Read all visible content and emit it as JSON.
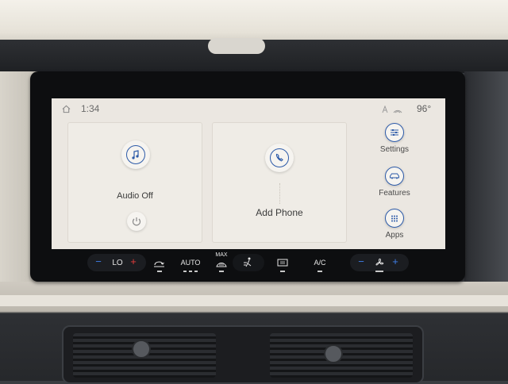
{
  "status": {
    "time": "1:34",
    "outside_temp": "96°"
  },
  "cards": {
    "audio": {
      "label": "Audio Off",
      "icon": "music-note-icon",
      "power_icon": "power-icon"
    },
    "phone": {
      "label": "Add Phone",
      "icon": "phone-icon"
    }
  },
  "side_menu": [
    {
      "label": "Settings",
      "icon": "sliders-icon"
    },
    {
      "label": "Features",
      "icon": "car-icon"
    },
    {
      "label": "Apps",
      "icon": "grid-dots-icon"
    }
  ],
  "climate": {
    "temp_minus": "−",
    "temp_value": "LO",
    "temp_plus": "+",
    "auto_label": "AUTO",
    "max_label": "MAX",
    "ac_label": "A/C",
    "fan_minus": "−",
    "fan_plus": "+"
  },
  "colors": {
    "accent": "#2c5aa8",
    "screen_bg": "#ebe7e1",
    "temp_plus": "#e33b3b",
    "climate_blue": "#3f7ee8"
  }
}
